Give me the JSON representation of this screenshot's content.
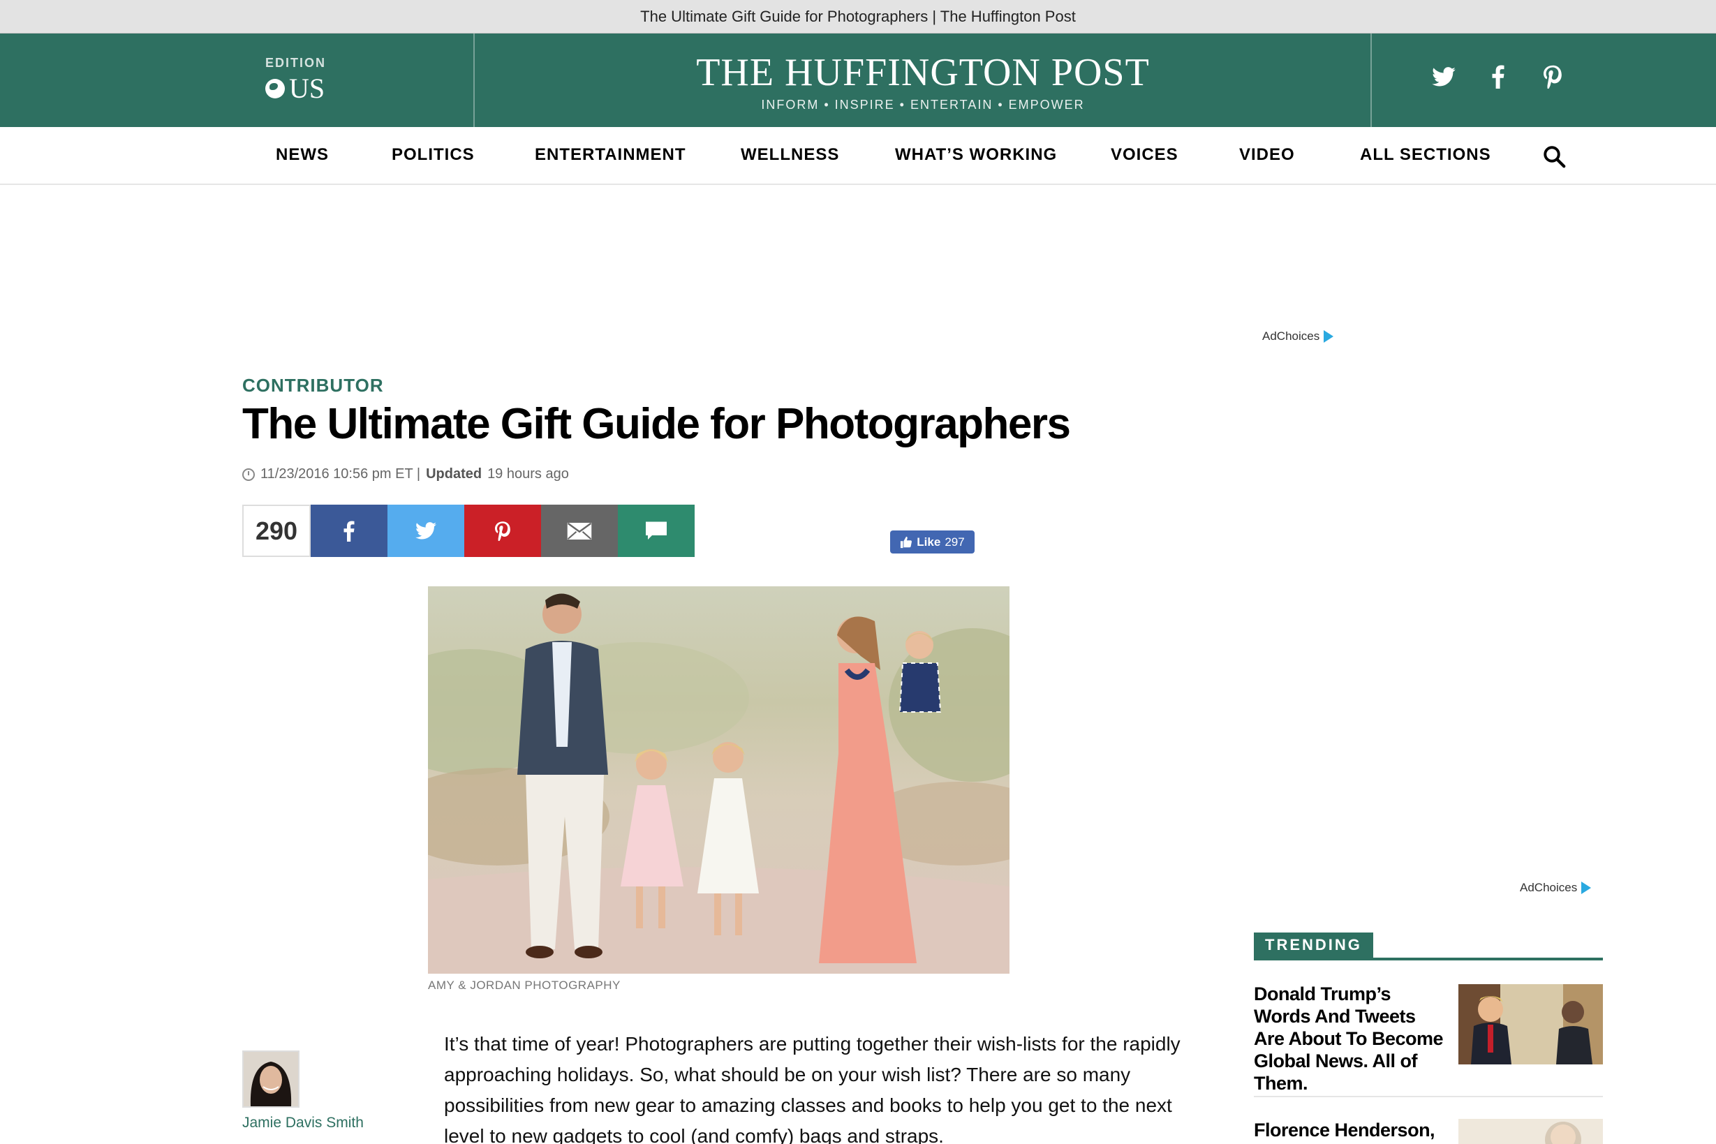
{
  "window": {
    "title": "The Ultimate Gift Guide for Photographers | The Huffington Post"
  },
  "header": {
    "edition_label": "EDITION",
    "edition_value": "US",
    "logo": "THE HUFFINGTON POST",
    "tagline": "INFORM • INSPIRE • ENTERTAIN • EMPOWER",
    "social_icons": [
      "twitter-icon",
      "facebook-icon",
      "pinterest-icon"
    ]
  },
  "nav": {
    "items": [
      "NEWS",
      "POLITICS",
      "ENTERTAINMENT",
      "WELLNESS",
      "WHAT’S WORKING",
      "VOICES",
      "VIDEO",
      "ALL SECTIONS"
    ],
    "search_icon": "search-icon"
  },
  "ads": {
    "adchoices_label": "AdChoices"
  },
  "article": {
    "kicker": "CONTRIBUTOR",
    "headline": "The Ultimate Gift Guide for Photographers",
    "timestamp": "11/23/2016 10:56 pm ET |",
    "updated_label": "Updated",
    "updated_value": "19 hours ago",
    "share_count": "290",
    "share_buttons": [
      {
        "icon": "facebook-icon",
        "color": "#3b5998"
      },
      {
        "icon": "twitter-icon",
        "color": "#55acee"
      },
      {
        "icon": "pinterest-icon",
        "color": "#cb2027"
      },
      {
        "icon": "email-icon",
        "color": "#666666"
      },
      {
        "icon": "comment-icon",
        "color": "#2e8b6e"
      }
    ],
    "fb_like_label": "Like",
    "fb_like_count": "297",
    "photo_caption": "AMY & JORDAN PHOTOGRAPHY",
    "author_name": "Jamie Davis Smith",
    "body": "It’s that time of year! Photographers are putting together their wish-lists for the rapidly approaching holidays. So, what should be on your wish list? There are so many possibilities from new gear to amazing classes and books to help you get to the next level to new gadgets to cool (and comfy) bags and straps."
  },
  "trending": {
    "label": "TRENDING",
    "items": [
      {
        "headline": "Donald Trump’s Words And Tweets Are About To Become Global News. All of Them."
      },
      {
        "headline": "Florence Henderson,"
      }
    ]
  },
  "colors": {
    "brand_green": "#2e7061",
    "facebook_blue": "#4267b2",
    "adchoices_blue": "#2aa9e0"
  }
}
